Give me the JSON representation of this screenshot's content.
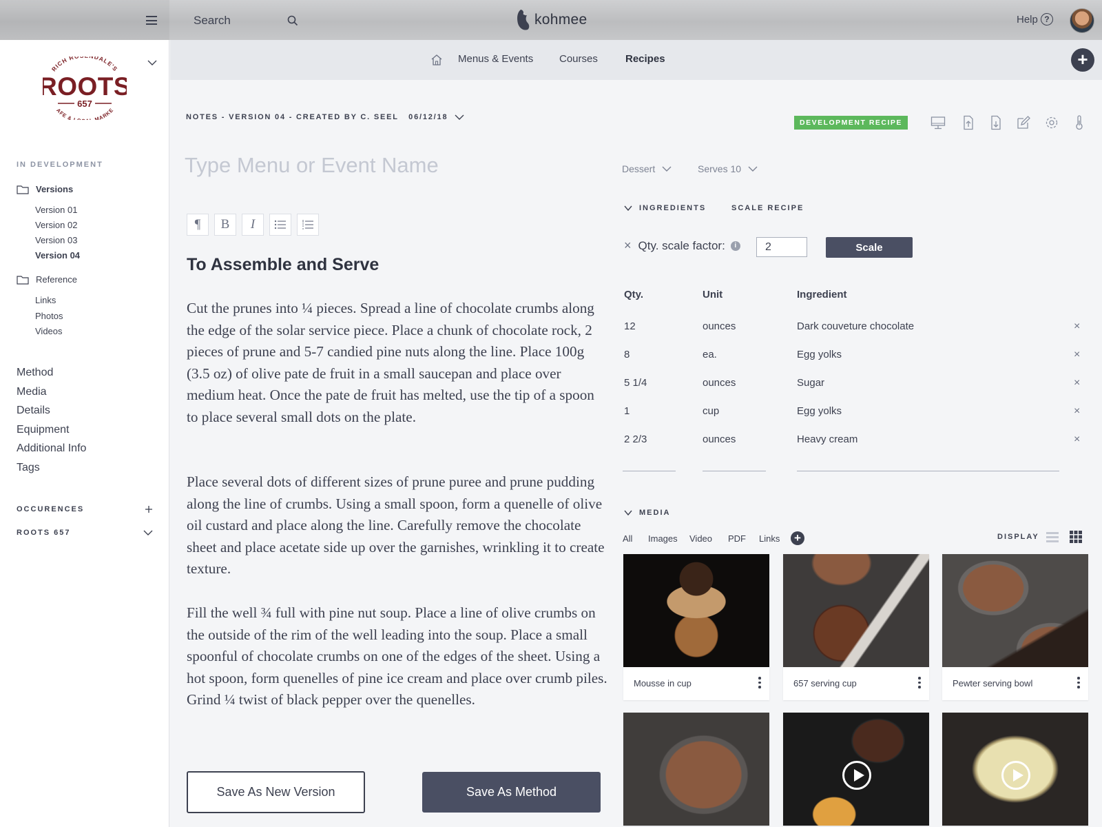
{
  "topbar": {
    "search_placeholder": "Search",
    "brand_name": "kohmee",
    "help_label": "Help",
    "help_icon": "?"
  },
  "sidebar": {
    "logo_text": {
      "top": "RICH ROSENDALE'S",
      "main": "ROOTS",
      "number": "657",
      "bottom": "CAFE & LOCAL MARKET"
    },
    "section_label": "IN DEVELOPMENT",
    "versions_folder": "Versions",
    "versions": [
      "Version 01",
      "Version 02",
      "Version 03",
      "Version 04"
    ],
    "active_version": "Version 04",
    "reference_folder": "Reference",
    "reference_items": [
      "Links",
      "Photos",
      "Videos"
    ],
    "links": [
      "Method",
      "Media",
      "Details",
      "Equipment",
      "Additional Info",
      "Tags"
    ],
    "occurences_label": "OCCURENCES",
    "roots_label": "ROOTS 657"
  },
  "subnav": {
    "items": [
      "Menus & Events",
      "Courses",
      "Recipes"
    ],
    "active": "Recipes",
    "add_symbol": "+"
  },
  "editor": {
    "notes_title": "NOTES - VERSION 04 - CREATED BY C. SEEL   06/12/18",
    "badge": "DEVELOPMENT RECIPE",
    "name_placeholder": "Type Menu or Event Name",
    "category": "Dessert",
    "serves": "Serves 10",
    "format_buttons": [
      "¶",
      "B",
      "I"
    ],
    "heading": "To Assemble and Serve",
    "paragraphs": [
      "Cut the prunes into ¼ pieces. Spread a line of chocolate crumbs along the edge of the solar service piece. Place a chunk of chocolate rock, 2 pieces of prune and 5-7 candied pine nuts along the line. Place 100g (3.5 oz) of olive pate de fruit in a small saucepan and place over medium heat. Once the pate de fruit has melted, use the tip of a spoon to place several small dots on the plate.",
      "Place several dots of different sizes of prune puree and prune pudding along the line of crumbs. Using a small spoon, form a quenelle of olive oil custard and place along the line. Carefully remove the chocolate sheet and place acetate side up over the garnishes, wrinkling it to create texture.",
      "Fill the well ¾ full with pine nut soup. Place a line of olive crumbs on the outside of the rim of the well leading into the soup.  Place a small spoonful of chocolate crumbs on one of the edges of the sheet. Using a hot spoon, form quenelles of pine ice cream and place over crumb piles. Grind ¼ twist of black pepper over the quenelles."
    ],
    "save_version_label": "Save As New Version",
    "save_method_label": "Save As Method"
  },
  "ingredients": {
    "section_label": "INGREDIENTS",
    "scale_recipe_label": "SCALE RECIPE",
    "scale_close": "×",
    "scale_factor_label": "Qty. scale factor:",
    "scale_info": "i",
    "scale_factor_value": "2",
    "scale_button": "Scale",
    "columns": [
      "Qty.",
      "Unit",
      "Ingredient"
    ],
    "rows": [
      {
        "qty": "12",
        "unit": "ounces",
        "ingredient": "Dark couveture chocolate"
      },
      {
        "qty": "8",
        "unit": "ea.",
        "ingredient": "Egg yolks"
      },
      {
        "qty": "5 1/4",
        "unit": "ounces",
        "ingredient": "Sugar"
      },
      {
        "qty": "1",
        "unit": "cup",
        "ingredient": "Egg yolks"
      },
      {
        "qty": "2 2/3",
        "unit": "ounces",
        "ingredient": "Heavy cream"
      }
    ],
    "remove_symbol": "×"
  },
  "media": {
    "section_label": "MEDIA",
    "tabs": [
      "All",
      "Images",
      "Video",
      "PDF",
      "Links"
    ],
    "add_symbol": "+",
    "display_label": "DISPLAY",
    "cards": [
      {
        "caption": "Mousse in cup",
        "type": "image"
      },
      {
        "caption": "657 serving cup",
        "type": "image"
      },
      {
        "caption": "Pewter serving bowl",
        "type": "image"
      },
      {
        "caption": "",
        "type": "image"
      },
      {
        "caption": "",
        "type": "video"
      },
      {
        "caption": "",
        "type": "video"
      }
    ]
  },
  "colors": {
    "dark": "#3d4150",
    "button": "#4a4f63",
    "badge": "#5cb85c",
    "logo": "#7a1f24"
  }
}
